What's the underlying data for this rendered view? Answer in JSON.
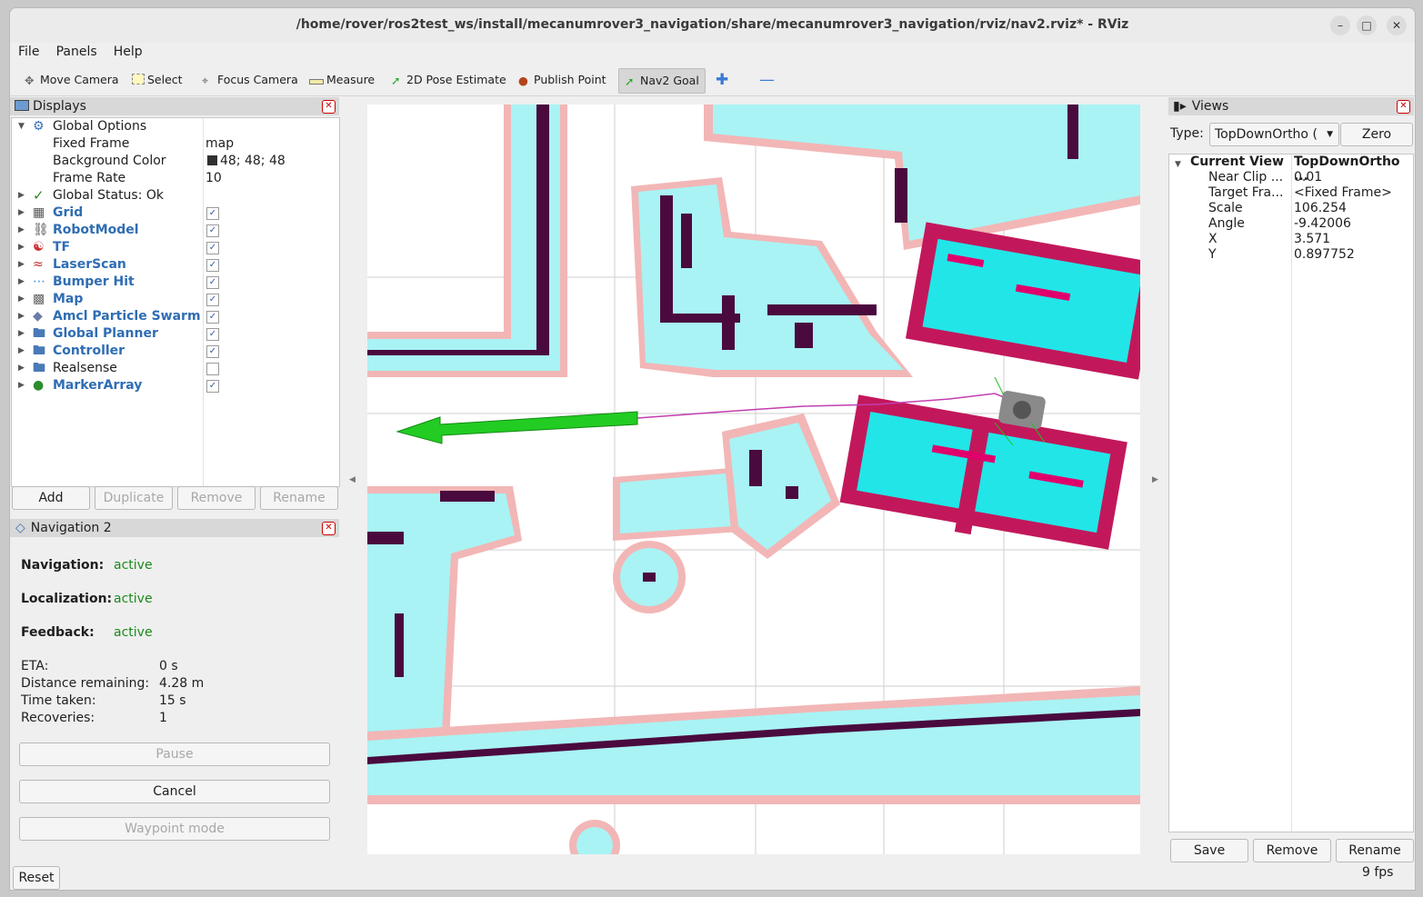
{
  "window": {
    "title": "/home/rover/ros2test_ws/install/mecanumrover3_navigation/share/mecanumrover3_navigation/rviz/nav2.rviz* - RViz"
  },
  "menu": [
    "File",
    "Panels",
    "Help"
  ],
  "toolbar": {
    "move_camera": "Move Camera",
    "select": "Select",
    "focus_camera": "Focus Camera",
    "measure": "Measure",
    "pose_estimate": "2D Pose Estimate",
    "publish_point": "Publish Point",
    "nav2_goal": "Nav2 Goal"
  },
  "displays": {
    "title": "Displays",
    "global_options": "Global Options",
    "fixed_frame_label": "Fixed Frame",
    "fixed_frame_value": "map",
    "bg_color_label": "Background Color",
    "bg_color_value": "48; 48; 48",
    "frame_rate_label": "Frame Rate",
    "frame_rate_value": "10",
    "global_status": "Global Status: Ok",
    "items": [
      {
        "label": "Grid",
        "checked": true
      },
      {
        "label": "RobotModel",
        "checked": true
      },
      {
        "label": "TF",
        "checked": true
      },
      {
        "label": "LaserScan",
        "checked": true
      },
      {
        "label": "Bumper Hit",
        "checked": true
      },
      {
        "label": "Map",
        "checked": true
      },
      {
        "label": "Amcl Particle Swarm",
        "checked": true
      },
      {
        "label": "Global Planner",
        "checked": true
      },
      {
        "label": "Controller",
        "checked": true
      },
      {
        "label": "Realsense",
        "checked": false
      },
      {
        "label": "MarkerArray",
        "checked": true
      }
    ],
    "buttons": {
      "add": "Add",
      "duplicate": "Duplicate",
      "remove": "Remove",
      "rename": "Rename"
    }
  },
  "nav2": {
    "title": "Navigation 2",
    "navigation_label": "Navigation:",
    "navigation_value": "active",
    "localization_label": "Localization:",
    "localization_value": "active",
    "feedback_label": "Feedback:",
    "feedback_value": "active",
    "eta_label": "ETA:",
    "eta_value": "0 s",
    "distance_label": "Distance remaining:",
    "distance_value": "4.28 m",
    "time_label": "Time taken:",
    "time_value": "15 s",
    "recoveries_label": "Recoveries:",
    "recoveries_value": "1",
    "pause": "Pause",
    "cancel": "Cancel",
    "waypoint": "Waypoint mode"
  },
  "views": {
    "title": "Views",
    "type_label": "Type:",
    "type_value": "TopDownOrtho (",
    "zero": "Zero",
    "current_view": "Current View",
    "current_view_value": "TopDownOrtho ...",
    "props": [
      {
        "k": "Near Clip ...",
        "v": "0.01"
      },
      {
        "k": "Target Fra...",
        "v": "<Fixed Frame>"
      },
      {
        "k": "Scale",
        "v": "106.254"
      },
      {
        "k": "Angle",
        "v": "-9.42006"
      },
      {
        "k": "X",
        "v": "3.571"
      },
      {
        "k": "Y",
        "v": "0.897752"
      }
    ],
    "save": "Save",
    "remove": "Remove",
    "rename": "Rename"
  },
  "status": {
    "reset": "Reset",
    "fps": "9 fps"
  },
  "colors": {
    "bg_swatch": "#303030",
    "costmap_cyan": "#a9f3f4",
    "costmap_pink": "#f2b6b6",
    "wall": "#4a0a3e",
    "goal_arrow": "#22cc22"
  }
}
